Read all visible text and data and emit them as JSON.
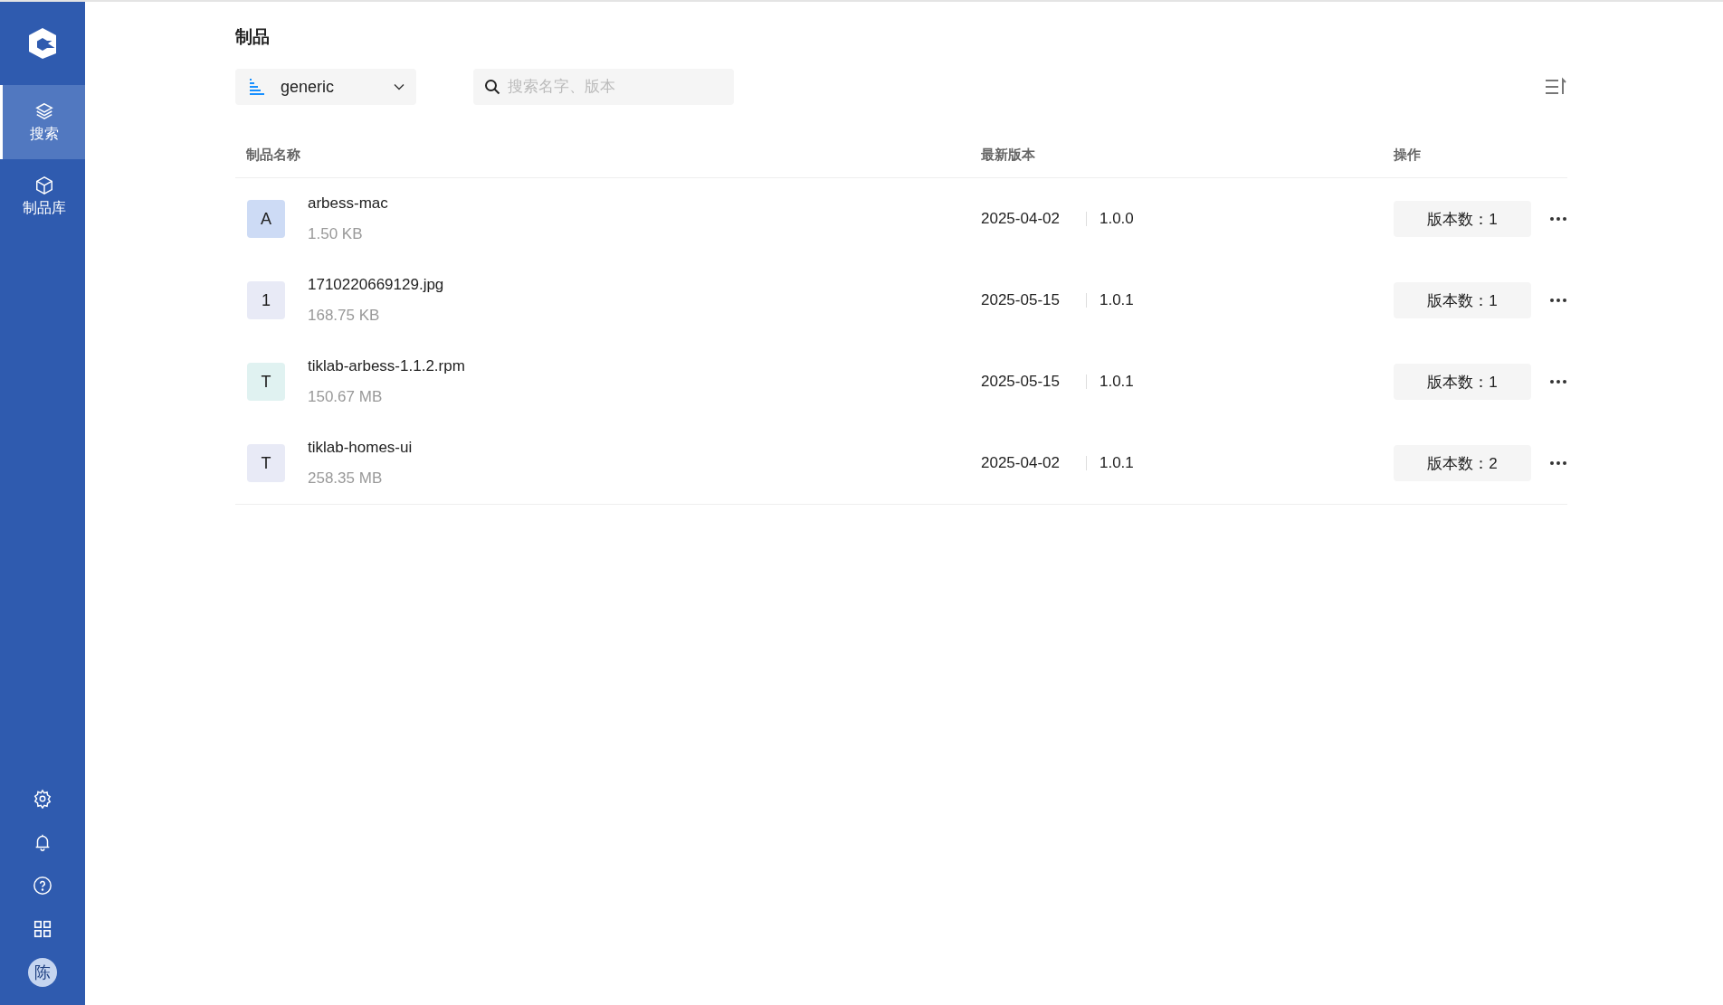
{
  "sidebar": {
    "items": [
      {
        "label": "搜索",
        "selected": true
      },
      {
        "label": "制品库",
        "selected": false
      }
    ],
    "avatar": "陈"
  },
  "page_title": "制品",
  "repo_select": {
    "value": "generic"
  },
  "search": {
    "placeholder": "搜索名字、版本"
  },
  "table": {
    "columns": [
      "制品名称",
      "最新版本",
      "操作"
    ],
    "rows": [
      {
        "initial": "A",
        "color": "#cddbf5",
        "name": "arbess-mac",
        "size": "1.50 KB",
        "date": "2025-04-02",
        "version": "1.0.0",
        "versions": "版本数：1"
      },
      {
        "initial": "1",
        "color": "#e8eaf6",
        "name": "1710220669129.jpg",
        "size": "168.75 KB",
        "date": "2025-05-15",
        "version": "1.0.1",
        "versions": "版本数：1"
      },
      {
        "initial": "T",
        "color": "#e0f2f1",
        "name": "tiklab-arbess-1.1.2.rpm",
        "size": "150.67 MB",
        "date": "2025-05-15",
        "version": "1.0.1",
        "versions": "版本数：1"
      },
      {
        "initial": "T",
        "color": "#e8eaf6",
        "name": "tiklab-homes-ui",
        "size": "258.35 MB",
        "date": "2025-04-02",
        "version": "1.0.1",
        "versions": "版本数：2"
      }
    ]
  }
}
